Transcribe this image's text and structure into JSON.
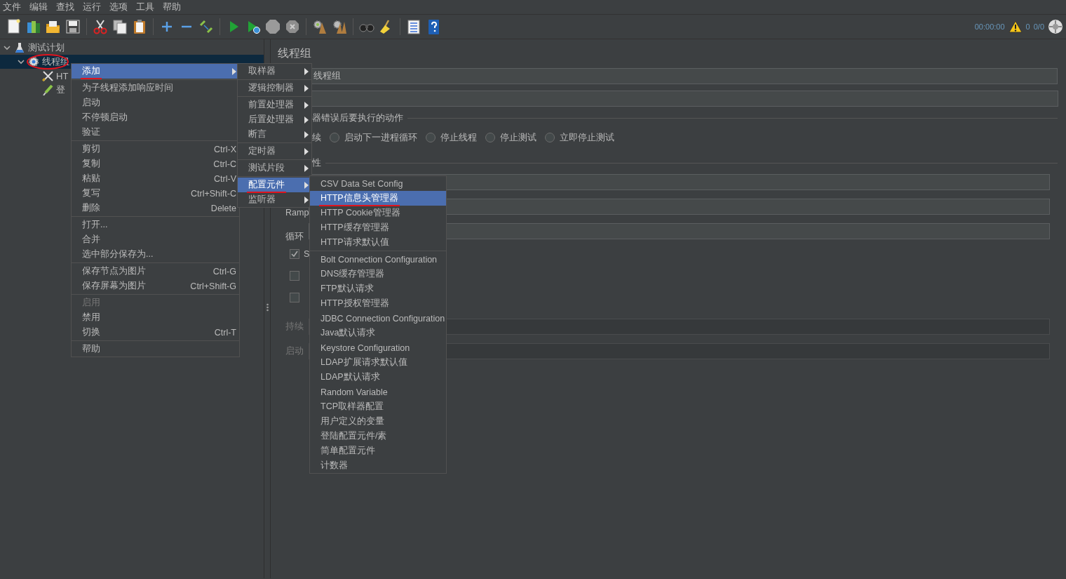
{
  "menubar": [
    "文件",
    "编辑",
    "查找",
    "运行",
    "选项",
    "工具",
    "帮助"
  ],
  "status": {
    "elapsed": "00:00:00",
    "warnings": "0",
    "threads": "0/0"
  },
  "tree": [
    {
      "label": "测试计划",
      "kind": "plan",
      "expanded": true,
      "selected": false,
      "circled": false,
      "children": [
        {
          "label": "线程组",
          "kind": "thread_group",
          "expanded": true,
          "selected": true,
          "circled": true,
          "children": [
            {
              "label": "HT",
              "kind": "sampler",
              "selected": false,
              "circled": false
            },
            {
              "label": "登",
              "kind": "extractor",
              "selected": false,
              "circled": false
            }
          ]
        }
      ]
    }
  ],
  "panel": {
    "title": "线程组",
    "name_value": "线程组",
    "error_legend": "器错误后要执行的动作",
    "error_partial": "续",
    "error_actions": [
      {
        "label": "启动下一进程循环",
        "selected": false
      },
      {
        "label": "停止线程",
        "selected": false
      },
      {
        "label": "停止测试",
        "selected": false
      },
      {
        "label": "立即停止测试",
        "selected": false
      }
    ],
    "props_legend": "性",
    "rows": [
      {
        "disabled": false
      },
      {
        "label": "Ramp",
        "disabled": false
      },
      {
        "label": "循环",
        "disabled": false
      }
    ],
    "checkboxes": [
      {
        "label": "S",
        "checked": true
      },
      {
        "checked": false
      },
      {
        "checked": false
      }
    ],
    "timing_rows": [
      {
        "label": "持续",
        "disabled": true
      },
      {
        "label": "启动",
        "disabled": true
      }
    ]
  },
  "context_menu": {
    "groups": [
      {
        "items": [
          {
            "label": "添加",
            "kind": "submenu",
            "selected": true,
            "disabled": false,
            "underlined": true
          }
        ]
      },
      {
        "items": [
          {
            "label": "为子线程添加响应时间",
            "kind": "command",
            "selected": false,
            "disabled": false,
            "underlined": false
          },
          {
            "label": "启动",
            "kind": "command",
            "selected": false,
            "disabled": false,
            "underlined": false
          },
          {
            "label": "不停顿启动",
            "kind": "command",
            "selected": false,
            "disabled": false,
            "underlined": false
          },
          {
            "label": "验证",
            "kind": "command",
            "selected": false,
            "disabled": false,
            "underlined": false
          }
        ]
      },
      {
        "items": [
          {
            "label": "剪切",
            "shortcut": "Ctrl-X",
            "kind": "command",
            "selected": false,
            "disabled": false,
            "underlined": false
          },
          {
            "label": "复制",
            "shortcut": "Ctrl-C",
            "kind": "command",
            "selected": false,
            "disabled": false,
            "underlined": false
          },
          {
            "label": "粘贴",
            "shortcut": "Ctrl-V",
            "kind": "command",
            "selected": false,
            "disabled": false,
            "underlined": false
          },
          {
            "label": "复写",
            "shortcut": "Ctrl+Shift-C",
            "kind": "command",
            "selected": false,
            "disabled": false,
            "underlined": false
          },
          {
            "label": "删除",
            "shortcut": "Delete",
            "kind": "command",
            "selected": false,
            "disabled": false,
            "underlined": false
          }
        ]
      },
      {
        "items": [
          {
            "label": "打开...",
            "kind": "command",
            "selected": false,
            "disabled": false,
            "underlined": false
          },
          {
            "label": "合并",
            "kind": "command",
            "selected": false,
            "disabled": false,
            "underlined": false
          },
          {
            "label": "选中部分保存为...",
            "kind": "command",
            "selected": false,
            "disabled": false,
            "underlined": false
          }
        ]
      },
      {
        "items": [
          {
            "label": "保存节点为图片",
            "shortcut": "Ctrl-G",
            "kind": "command",
            "selected": false,
            "disabled": false,
            "underlined": false
          },
          {
            "label": "保存屏幕为图片",
            "shortcut": "Ctrl+Shift-G",
            "kind": "command",
            "selected": false,
            "disabled": false,
            "underlined": false
          }
        ]
      },
      {
        "items": [
          {
            "label": "启用",
            "kind": "command",
            "selected": false,
            "disabled": true,
            "underlined": false
          },
          {
            "label": "禁用",
            "kind": "command",
            "selected": false,
            "disabled": false,
            "underlined": false
          },
          {
            "label": "切换",
            "shortcut": "Ctrl-T",
            "kind": "command",
            "selected": false,
            "disabled": false,
            "underlined": false
          }
        ]
      },
      {
        "items": [
          {
            "label": "帮助",
            "kind": "command",
            "selected": false,
            "disabled": false,
            "underlined": false
          }
        ]
      }
    ]
  },
  "add_menu": {
    "groups": [
      {
        "items": [
          {
            "label": "取样器",
            "kind": "submenu",
            "selected": false,
            "underlined": false
          }
        ]
      },
      {
        "items": [
          {
            "label": "逻辑控制器",
            "kind": "submenu",
            "selected": false,
            "underlined": false
          }
        ]
      },
      {
        "items": [
          {
            "label": "前置处理器",
            "kind": "submenu",
            "selected": false,
            "underlined": false
          },
          {
            "label": "后置处理器",
            "kind": "submenu",
            "selected": false,
            "underlined": false
          },
          {
            "label": "断言",
            "kind": "submenu",
            "selected": false,
            "underlined": false
          }
        ]
      },
      {
        "items": [
          {
            "label": "定时器",
            "kind": "submenu",
            "selected": false,
            "underlined": false
          }
        ]
      },
      {
        "items": [
          {
            "label": "测试片段",
            "kind": "submenu",
            "selected": false,
            "underlined": false
          }
        ]
      },
      {
        "items": [
          {
            "label": "配置元件",
            "kind": "submenu",
            "selected": true,
            "underlined": true
          },
          {
            "label": "监听器",
            "kind": "submenu",
            "selected": false,
            "underlined": false
          }
        ]
      }
    ]
  },
  "config_menu": {
    "groups": [
      {
        "items": [
          {
            "label": "CSV Data Set Config",
            "selected": false,
            "underlined": false
          },
          {
            "label": "HTTP信息头管理器",
            "selected": true,
            "underlined": true
          },
          {
            "label": "HTTP Cookie管理器",
            "selected": false,
            "underlined": false
          },
          {
            "label": "HTTP缓存管理器",
            "selected": false,
            "underlined": false
          },
          {
            "label": "HTTP请求默认值",
            "selected": false,
            "underlined": false
          }
        ]
      },
      {
        "items": [
          {
            "label": "Bolt Connection Configuration",
            "selected": false,
            "underlined": false
          },
          {
            "label": "DNS缓存管理器",
            "selected": false,
            "underlined": false
          },
          {
            "label": "FTP默认请求",
            "selected": false,
            "underlined": false
          },
          {
            "label": "HTTP授权管理器",
            "selected": false,
            "underlined": false
          },
          {
            "label": "JDBC Connection Configuration",
            "selected": false,
            "underlined": false
          },
          {
            "label": "Java默认请求",
            "selected": false,
            "underlined": false
          },
          {
            "label": "Keystore Configuration",
            "selected": false,
            "underlined": false
          },
          {
            "label": "LDAP扩展请求默认值",
            "selected": false,
            "underlined": false
          },
          {
            "label": "LDAP默认请求",
            "selected": false,
            "underlined": false
          },
          {
            "label": "Random Variable",
            "selected": false,
            "underlined": false
          },
          {
            "label": "TCP取样器配置",
            "selected": false,
            "underlined": false
          },
          {
            "label": "用户定义的变量",
            "selected": false,
            "underlined": false
          },
          {
            "label": "登陆配置元件/素",
            "selected": false,
            "underlined": false
          },
          {
            "label": "简单配置元件",
            "selected": false,
            "underlined": false
          },
          {
            "label": "计数器",
            "selected": false,
            "underlined": false
          }
        ]
      }
    ]
  }
}
